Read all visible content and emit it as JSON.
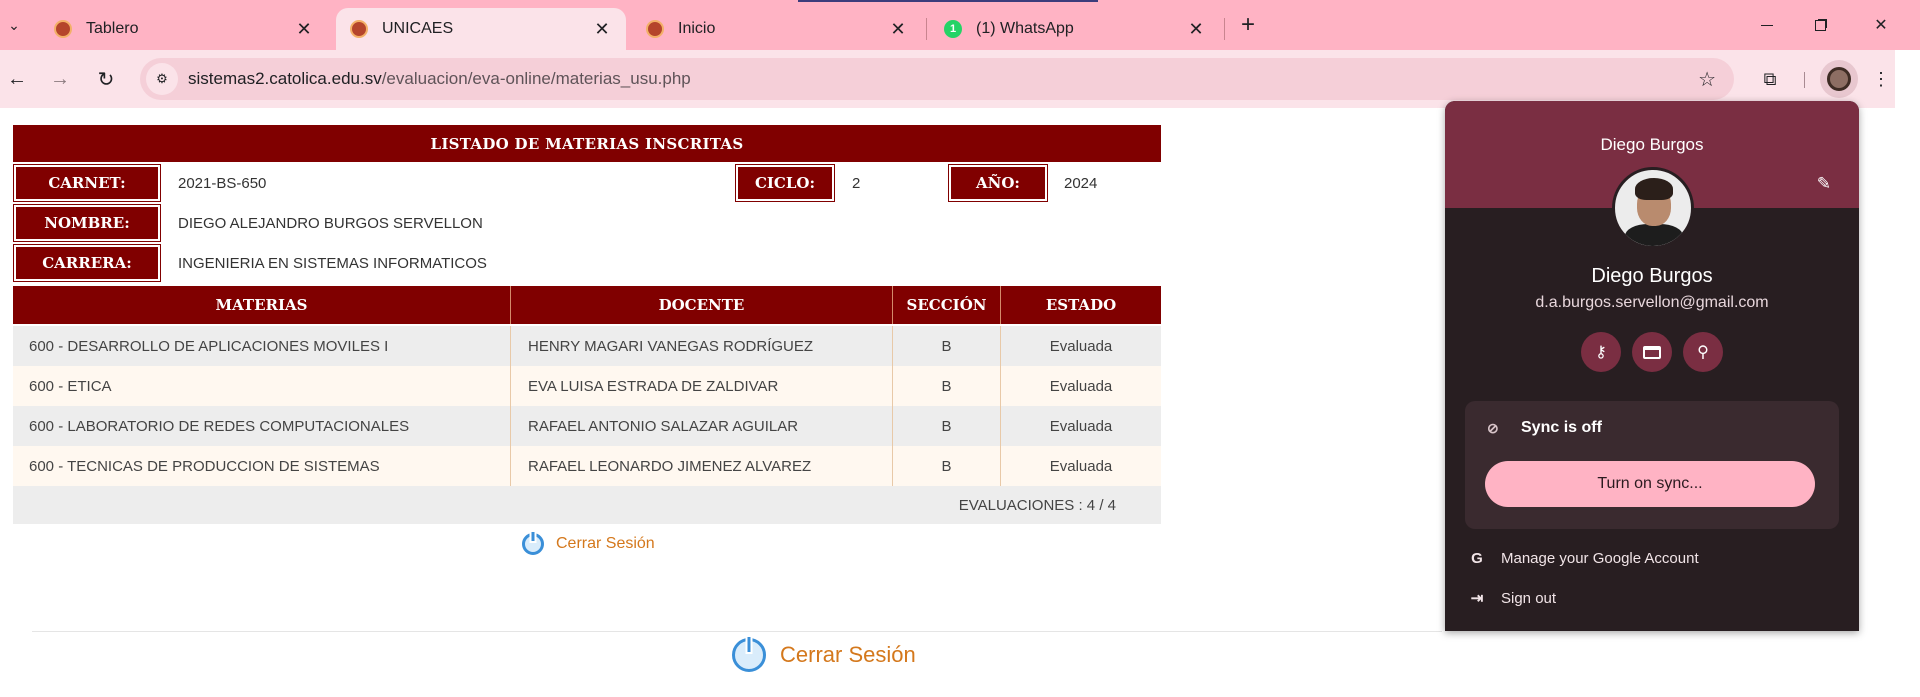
{
  "browser": {
    "tabs": [
      {
        "title": "Tablero",
        "close": "✕"
      },
      {
        "title": "UNICAES",
        "close": "✕"
      },
      {
        "title": "Inicio",
        "close": "✕"
      },
      {
        "title": "(1) WhatsApp",
        "close": "✕",
        "badge": "1"
      }
    ],
    "new_tab": "+",
    "url_domain": "sistemas2.catolica.edu.sv",
    "url_path": "/evaluacion/eva-online/materias_usu.php",
    "colors": {
      "tabstrip": "#ffb3c4",
      "toolbar": "#fbe3e9"
    }
  },
  "page": {
    "header_title": "LISTADO DE MATERIAS INSCRITAS",
    "carnet_label": "CARNET:",
    "carnet_value": "2021-BS-650",
    "ciclo_label": "CICLO:",
    "ciclo_value": "2",
    "anio_label": "AÑO:",
    "anio_value": "2024",
    "nombre_label": "NOMBRE:",
    "nombre_value": "DIEGO ALEJANDRO BURGOS SERVELLON",
    "carrera_label": "CARRERA:",
    "carrera_value": "INGENIERIA EN SISTEMAS INFORMATICOS",
    "columns": [
      "MATERIAS",
      "DOCENTE",
      "SECCIÓN",
      "ESTADO"
    ],
    "rows": [
      {
        "materia": "600 - DESARROLLO DE APLICACIONES MOVILES I",
        "docente": "HENRY MAGARI VANEGAS RODRÍGUEZ",
        "seccion": "B",
        "estado": "Evaluada"
      },
      {
        "materia": "600 - ETICA",
        "docente": "EVA LUISA ESTRADA DE ZALDIVAR",
        "seccion": "B",
        "estado": "Evaluada"
      },
      {
        "materia": "600 - LABORATORIO DE REDES COMPUTACIONALES",
        "docente": "RAFAEL ANTONIO SALAZAR AGUILAR",
        "seccion": "B",
        "estado": "Evaluada"
      },
      {
        "materia": "600 - TECNICAS DE PRODUCCION DE SISTEMAS",
        "docente": "RAFAEL LEONARDO JIMENEZ ALVAREZ",
        "seccion": "B",
        "estado": "Evaluada"
      }
    ],
    "summary": "EVALUACIONES : 4 / 4",
    "logout_label": "Cerrar Sesión",
    "colors": {
      "primary": "#800000",
      "link": "#d4781c"
    }
  },
  "profile_popup": {
    "header_name": "Diego Burgos",
    "name": "Diego Burgos",
    "email": "d.a.burgos.servellon@gmail.com",
    "sync_status": "Sync is off",
    "sync_button": "Turn on sync...",
    "manage_account": "Manage your Google Account",
    "sign_out": "Sign out",
    "google_glyph": "G",
    "colors": {
      "background": "#281e21",
      "header": "#7a2e42",
      "sync_button": "#ffb3c4"
    }
  }
}
